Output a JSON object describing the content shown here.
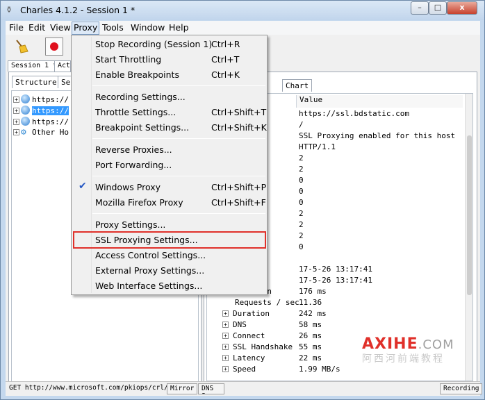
{
  "window": {
    "title": "Charles 4.1.2 - Session 1 *",
    "min_label": "–",
    "max_label": "□",
    "close_label": "x"
  },
  "menubar": [
    "File",
    "Edit",
    "View",
    "Proxy",
    "Tools",
    "Window",
    "Help"
  ],
  "session_tabs": [
    "Session 1 *",
    "Acti"
  ],
  "left_tabs": [
    "Structure",
    "Seq"
  ],
  "tree": [
    {
      "label": "https://",
      "icon": "globe-icon"
    },
    {
      "label": "https://",
      "icon": "globe-icon",
      "selected": true
    },
    {
      "label": "https://",
      "icon": "globe-icon"
    },
    {
      "label": "Other Ho",
      "icon": "gear-icon"
    }
  ],
  "right_tabs": [
    "ry",
    "Chart"
  ],
  "table_header": {
    "value": "Value"
  },
  "table_rows": [
    {
      "name": "",
      "value": "https://ssl.bdstatic.com"
    },
    {
      "name": "",
      "value": "/"
    },
    {
      "name": "",
      "value": "SSL Proxying enabled for this host"
    },
    {
      "name": "",
      "value": "HTTP/1.1"
    },
    {
      "name": "",
      "value": "2"
    },
    {
      "name": "",
      "value": "2"
    },
    {
      "name": "",
      "value": "0"
    },
    {
      "name": "",
      "value": "0"
    },
    {
      "name": "",
      "value": "0"
    },
    {
      "name": "",
      "value": "2"
    },
    {
      "name": "",
      "value": "2"
    },
    {
      "name": "akes",
      "value": "2"
    },
    {
      "name": "",
      "value": "0"
    },
    {
      "name": "",
      "value": ""
    },
    {
      "name": "",
      "value": "17-5-26 13:17:41"
    },
    {
      "name": "",
      "value": "17-5-26 13:17:41"
    },
    {
      "name": "Timespan",
      "value": "176 ms"
    },
    {
      "name": "Requests / sec",
      "value": "11.36"
    },
    {
      "name": "Duration",
      "value": "242 ms",
      "expandable": true
    },
    {
      "name": "DNS",
      "value": "58 ms",
      "expandable": true
    },
    {
      "name": "Connect",
      "value": "26 ms",
      "expandable": true
    },
    {
      "name": "SSL Handshake",
      "value": "55 ms",
      "expandable": true
    },
    {
      "name": "Latency",
      "value": "22 ms",
      "expandable": true
    },
    {
      "name": "Speed",
      "value": "1.99 MB/s",
      "expandable": true
    }
  ],
  "status": {
    "text": "GET http://www.microsoft.com/pkiops/crl/M...",
    "mirror": "Mirror",
    "dns": "DNS Sp",
    "recording": "Recording"
  },
  "proxy_menu": {
    "groups": [
      [
        {
          "label": "Stop Recording (Session 1)",
          "shortcut": "Ctrl+R"
        },
        {
          "label": "Start Throttling",
          "shortcut": "Ctrl+T"
        },
        {
          "label": "Enable Breakpoints",
          "shortcut": "Ctrl+K"
        }
      ],
      [
        {
          "label": "Recording Settings...",
          "shortcut": ""
        },
        {
          "label": "Throttle Settings...",
          "shortcut": "Ctrl+Shift+T"
        },
        {
          "label": "Breakpoint Settings...",
          "shortcut": "Ctrl+Shift+K"
        }
      ],
      [
        {
          "label": "Reverse Proxies...",
          "shortcut": ""
        },
        {
          "label": "Port Forwarding...",
          "shortcut": ""
        }
      ],
      [
        {
          "label": "Windows Proxy",
          "shortcut": "Ctrl+Shift+P",
          "checked": true
        },
        {
          "label": "Mozilla Firefox Proxy",
          "shortcut": "Ctrl+Shift+F"
        }
      ],
      [
        {
          "label": "Proxy Settings...",
          "shortcut": ""
        },
        {
          "label": "SSL Proxying Settings...",
          "shortcut": "",
          "highlighted": true
        },
        {
          "label": "Access Control Settings...",
          "shortcut": ""
        },
        {
          "label": "External Proxy Settings...",
          "shortcut": ""
        },
        {
          "label": "Web Interface Settings...",
          "shortcut": ""
        }
      ]
    ],
    "check_mark": "✔"
  },
  "watermark": {
    "brand": "AXIHE",
    "domain": ".COM",
    "subtitle": "阿西河前端教程"
  },
  "colors": {
    "accent_red": "#e0302a",
    "selection": "#3399ff",
    "record_red": "#e0101d"
  }
}
